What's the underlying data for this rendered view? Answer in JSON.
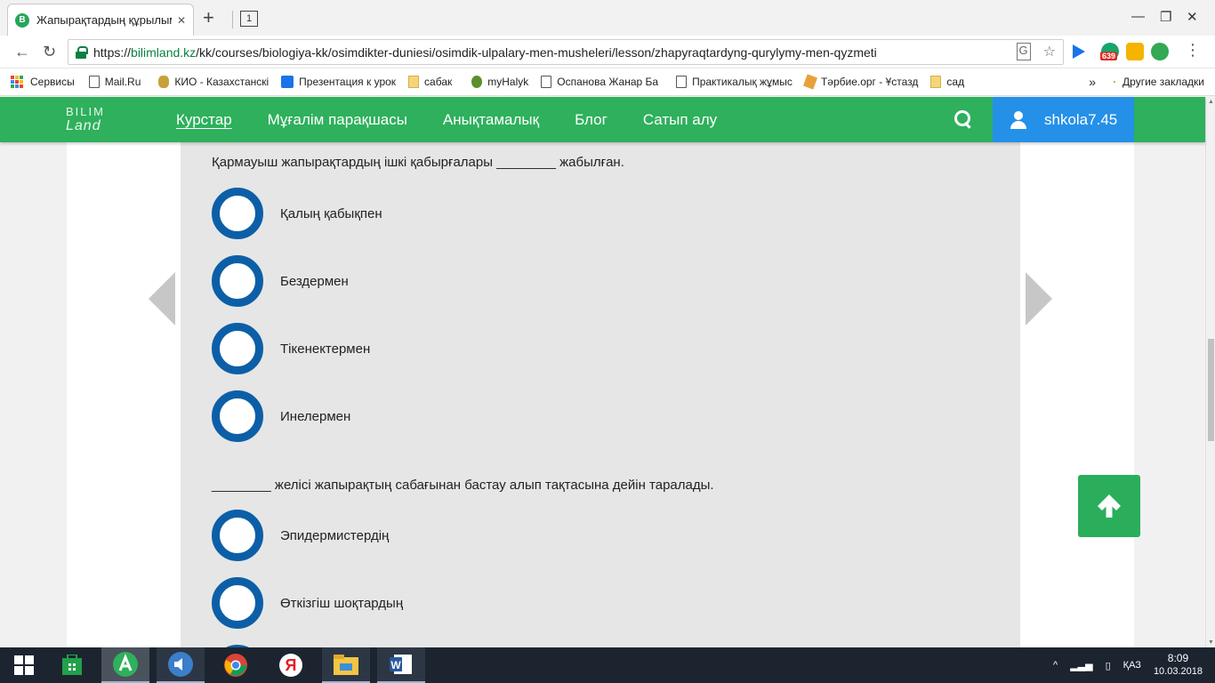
{
  "browser": {
    "tab_title": "Жапырақтардың құрылымы",
    "tab_favicon": "B",
    "tab_count": "1",
    "url_scheme": "https://",
    "url_host": "bilimland.kz",
    "url_path": "/kk/courses/biologiya-kk/osimdikter-duniesi/osimdik-ulpalary-men-musheleri/lesson/zhapyraqtardyng-qurylymy-men-qyzmeti",
    "extension_badge": "639"
  },
  "bookmarks": {
    "items": [
      {
        "label": "Сервисы",
        "icon": "apps-icon"
      },
      {
        "label": "Mail.Ru",
        "icon": "page-icon"
      },
      {
        "label": "КИО - Казахстанскі",
        "icon": "kio-icon"
      },
      {
        "label": "Презентация к урок",
        "icon": "checkbox-icon"
      },
      {
        "label": "сабак",
        "icon": "folder-icon"
      },
      {
        "label": "myHalyk",
        "icon": "halyk-icon"
      },
      {
        "label": "Оспанова Жанар Ба",
        "icon": "page-icon"
      },
      {
        "label": "Практикалық жұмыс",
        "icon": "page-icon"
      },
      {
        "label": "Тәрбие.орг - Ұстазд",
        "icon": "tarbie-icon"
      },
      {
        "label": "сад",
        "icon": "folder-icon"
      }
    ],
    "overflow": "»",
    "other_label": "Другие закладки"
  },
  "site": {
    "logo_line1": "BILIM",
    "logo_line2": "Land",
    "nav": [
      "Курстар",
      "Мұғалім парақшасы",
      "Анықтамалық",
      "Блог",
      "Сатып алу"
    ],
    "username": "shkola7.45"
  },
  "quiz": {
    "q1": {
      "text": "Қармауыш жапырақтардың ішкі қабырғалары ________ жабылған.",
      "options": [
        "Қалың қабықпен",
        "Бездермен",
        "Тікенектермен",
        "Инелермен"
      ]
    },
    "q2": {
      "text": "________ желісі жапырақтың сабағынан бастау алып тақтасына дейін таралады.",
      "options": [
        "Эпидермистердің",
        "Өткізгіш шоқтардың"
      ]
    }
  },
  "taskbar": {
    "lang": "ҚАЗ",
    "time": "8:09",
    "date": "10.03.2018"
  },
  "colors": {
    "header_green": "#2eb05c",
    "user_blue": "#2590e8",
    "radio_blue": "#0c5fa7",
    "quiz_bg": "#e6e6e6"
  }
}
